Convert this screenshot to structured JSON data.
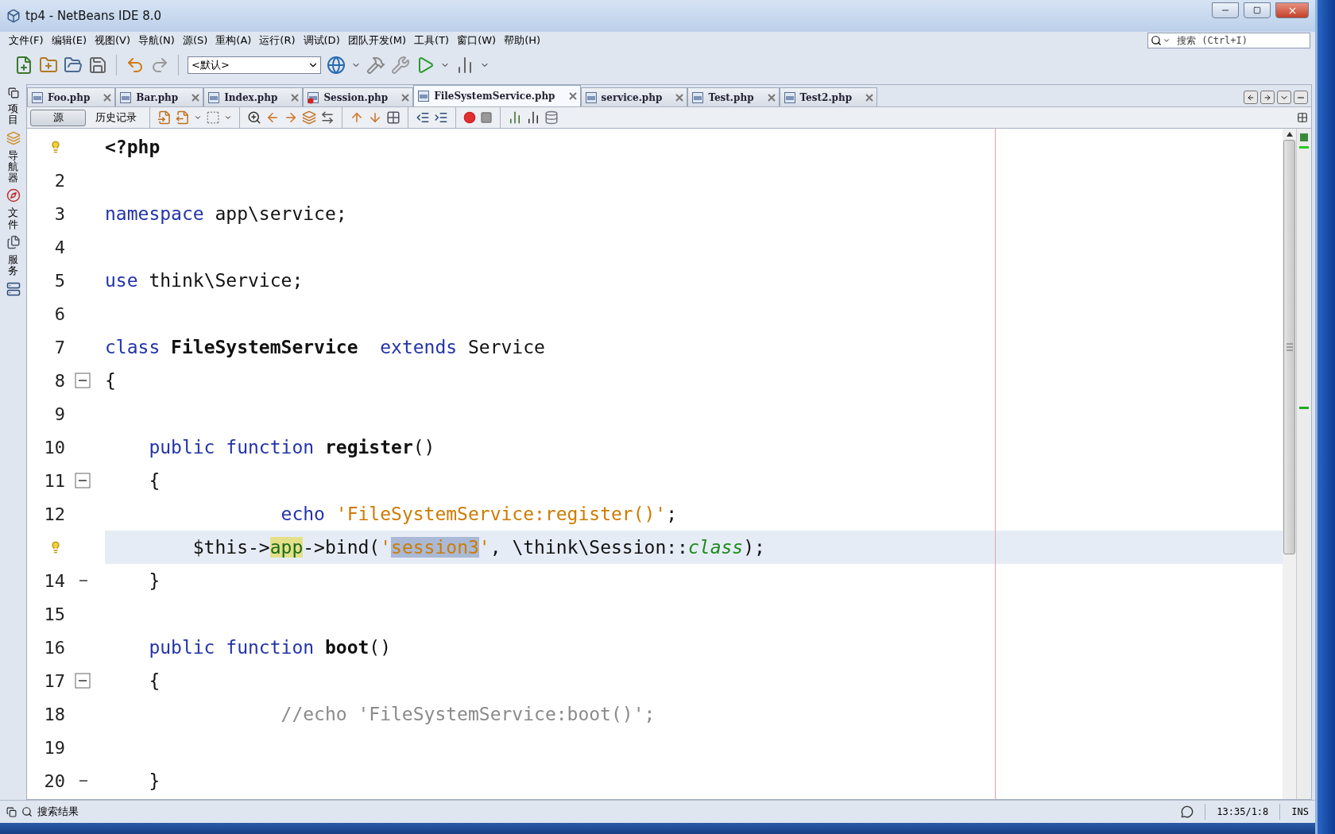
{
  "window": {
    "title": "tp4 - NetBeans IDE 8.0"
  },
  "menu": [
    "文件(F)",
    "编辑(E)",
    "视图(V)",
    "导航(N)",
    "源(S)",
    "重构(A)",
    "运行(R)",
    "调试(D)",
    "团队开发(M)",
    "工具(T)",
    "窗口(W)",
    "帮助(H)"
  ],
  "search": {
    "placeholder": "搜索 (Ctrl+I)"
  },
  "toolbar": {
    "configuration": "<默认>"
  },
  "tabs": [
    {
      "label": "Foo.php",
      "selected": false,
      "error": false
    },
    {
      "label": "Bar.php",
      "selected": false,
      "error": false
    },
    {
      "label": "Index.php",
      "selected": false,
      "error": false
    },
    {
      "label": "Session.php",
      "selected": false,
      "error": true
    },
    {
      "label": "FileSystemService.php",
      "selected": true,
      "error": false
    },
    {
      "label": "service.php",
      "selected": false,
      "error": false
    },
    {
      "label": "Test.php",
      "selected": false,
      "error": false
    },
    {
      "label": "Test2.php",
      "selected": false,
      "error": false
    }
  ],
  "editor_views": [
    {
      "label": "源",
      "selected": true
    },
    {
      "label": "历史记录",
      "selected": false
    }
  ],
  "side_panels": [
    "项目",
    "导航器",
    "文件",
    "服务"
  ],
  "editor": {
    "lines": [
      {
        "hint": true,
        "fold_start": false,
        "fold_end": false,
        "current": false,
        "tokens": [
          {
            "text": "<?php",
            "kind": "bold"
          }
        ]
      },
      {
        "number": "2",
        "hint": false,
        "fold_start": false,
        "fold_end": false,
        "current": false
      },
      {
        "number": "3",
        "hint": false,
        "fold_start": false,
        "fold_end": false,
        "current": false,
        "tokens": [
          {
            "text": "namespace",
            "kind": "keyword"
          },
          {
            "text": " app\\service;",
            "kind": "plain"
          }
        ]
      },
      {
        "number": "4",
        "hint": false,
        "fold_start": false,
        "fold_end": false,
        "current": false
      },
      {
        "number": "5",
        "hint": false,
        "fold_start": false,
        "fold_end": false,
        "current": false,
        "tokens": [
          {
            "text": "use",
            "kind": "keyword"
          },
          {
            "text": " think\\Service;",
            "kind": "plain"
          }
        ]
      },
      {
        "number": "6",
        "hint": false,
        "fold_start": false,
        "fold_end": false,
        "current": false
      },
      {
        "number": "7",
        "hint": false,
        "fold_start": false,
        "fold_end": false,
        "current": false,
        "tokens": [
          {
            "text": "class ",
            "kind": "keyword"
          },
          {
            "text": "FileSystemService",
            "kind": "bold"
          },
          {
            "text": "  extends",
            "kind": "keyword"
          },
          {
            "text": " Service",
            "kind": "plain"
          }
        ]
      },
      {
        "number": "8",
        "hint": false,
        "fold_start": true,
        "fold_end": false,
        "current": false,
        "tokens": [
          {
            "text": "{",
            "kind": "plain"
          }
        ]
      },
      {
        "number": "9",
        "hint": false,
        "fold_start": false,
        "fold_end": false,
        "current": false
      },
      {
        "number": "10",
        "hint": false,
        "fold_start": false,
        "fold_end": false,
        "current": false,
        "tokens": [
          {
            "text": "    public function ",
            "kind": "keyword"
          },
          {
            "text": "register",
            "kind": "bold"
          },
          {
            "text": "()",
            "kind": "plain"
          }
        ]
      },
      {
        "number": "11",
        "hint": false,
        "fold_start": true,
        "fold_end": false,
        "current": false,
        "tokens": [
          {
            "text": "    {",
            "kind": "plain"
          }
        ]
      },
      {
        "number": "12",
        "hint": false,
        "fold_start": false,
        "fold_end": false,
        "current": false,
        "tokens": [
          {
            "text": "                echo ",
            "kind": "keyword"
          },
          {
            "text": "'FileSystemService:register()'",
            "kind": "string"
          },
          {
            "text": ";",
            "kind": "plain"
          }
        ]
      },
      {
        "hint": true,
        "fold_start": false,
        "fold_end": false,
        "current": true,
        "tokens": [
          {
            "text": "        $this->",
            "kind": "plain"
          },
          {
            "text": "app",
            "kind": "marked"
          },
          {
            "text": "->bind(",
            "kind": "plain"
          },
          {
            "text": "'",
            "kind": "string"
          },
          {
            "text": "session3",
            "kind": "selected"
          },
          {
            "text": "'",
            "kind": "string"
          },
          {
            "text": ", \\think\\Session::",
            "kind": "plain"
          },
          {
            "text": "class",
            "kind": "italic"
          },
          {
            "text": ");",
            "kind": "plain"
          }
        ]
      },
      {
        "number": "14",
        "hint": false,
        "fold_start": false,
        "fold_end": true,
        "current": false,
        "tokens": [
          {
            "text": "    }",
            "kind": "plain"
          }
        ]
      },
      {
        "number": "15",
        "hint": false,
        "fold_start": false,
        "fold_end": false,
        "current": false
      },
      {
        "number": "16",
        "hint": false,
        "fold_start": false,
        "fold_end": false,
        "current": false,
        "tokens": [
          {
            "text": "    public function ",
            "kind": "keyword"
          },
          {
            "text": "boot",
            "kind": "bold"
          },
          {
            "text": "()",
            "kind": "plain"
          }
        ]
      },
      {
        "number": "17",
        "hint": false,
        "fold_start": true,
        "fold_end": false,
        "current": false,
        "tokens": [
          {
            "text": "    {",
            "kind": "plain"
          }
        ]
      },
      {
        "number": "18",
        "hint": false,
        "fold_start": false,
        "fold_end": false,
        "current": false,
        "tokens": [
          {
            "text": "                //echo 'FileSystemService:boot()';",
            "kind": "comment"
          }
        ]
      },
      {
        "number": "19",
        "hint": false,
        "fold_start": false,
        "fold_end": false,
        "current": false
      },
      {
        "number": "20",
        "hint": false,
        "fold_start": false,
        "fold_end": true,
        "current": false,
        "tokens": [
          {
            "text": "    }",
            "kind": "plain"
          }
        ]
      }
    ]
  },
  "status_bar": {
    "panel": "搜索结果",
    "position": "13:35/1:8",
    "mode": "INS"
  }
}
